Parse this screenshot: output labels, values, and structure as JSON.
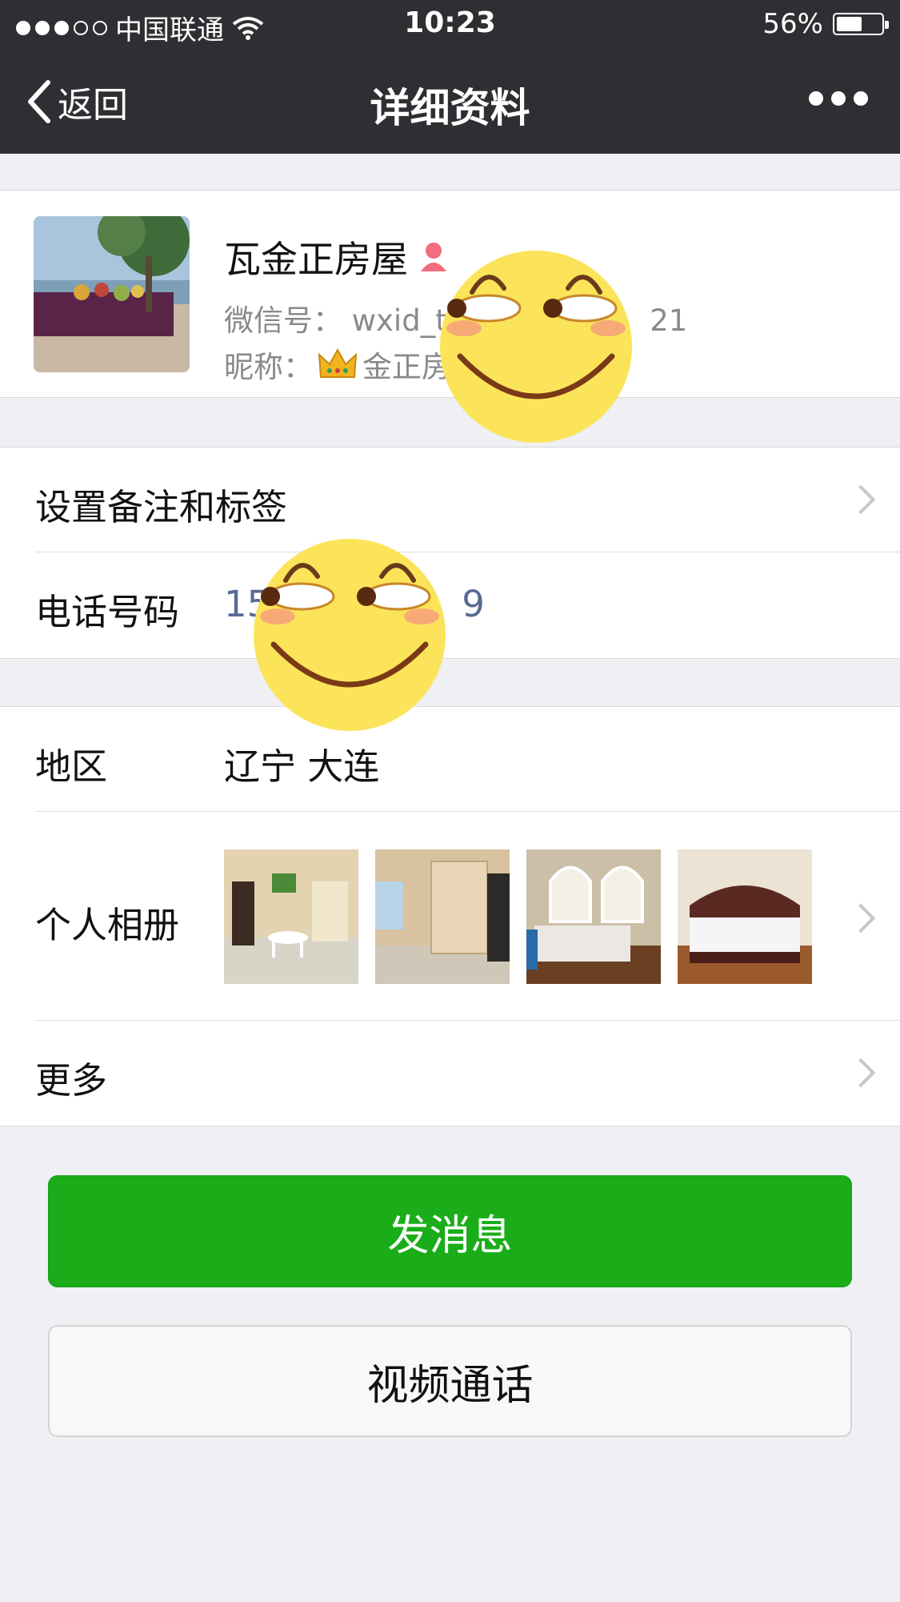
{
  "status_bar": {
    "carrier": "中国联通",
    "time": "10:23",
    "battery_percent": "56%",
    "battery_level": 0.56,
    "signal_bars_filled": 3,
    "signal_bars_total": 5
  },
  "nav": {
    "back_label": "返回",
    "title": "详细资料"
  },
  "profile": {
    "name": "瓦金正房屋",
    "wechat_id_label": "微信号：",
    "wechat_id_visible_start": "wxid_t",
    "wechat_id_visible_end": "21",
    "nickname_label": "昵称：",
    "nickname_visible": "金正房",
    "gender_icon": "female-icon"
  },
  "rows": {
    "remark_label": "设置备注和标签",
    "phone_label": "电话号码",
    "phone_visible_start": "15",
    "phone_visible_end": "9",
    "region_label": "地区",
    "region_value": "辽宁 大连",
    "album_label": "个人相册",
    "more_label": "更多"
  },
  "buttons": {
    "message": "发消息",
    "video_call": "视频通话"
  },
  "colors": {
    "nav_bg": "#2f2f33",
    "green": "#1aad19",
    "link_blue": "#576b95"
  }
}
